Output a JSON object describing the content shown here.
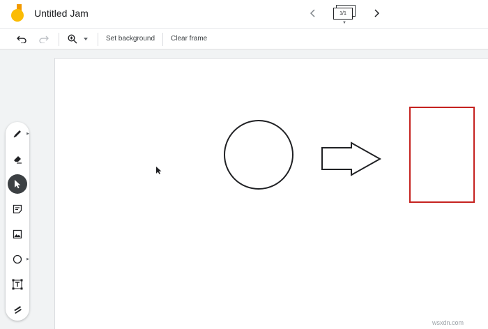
{
  "header": {
    "title": "Untitled Jam",
    "frame_indicator": "1/1",
    "logo_icon": "jamboard-logo"
  },
  "toolbar": {
    "set_background_label": "Set background",
    "clear_frame_label": "Clear frame"
  },
  "tools": [
    {
      "name": "pen",
      "icon": "pen-icon",
      "active": false
    },
    {
      "name": "eraser",
      "icon": "eraser-icon",
      "active": false
    },
    {
      "name": "select",
      "icon": "cursor-icon",
      "active": true
    },
    {
      "name": "sticky-note",
      "icon": "sticky-note-icon",
      "active": false
    },
    {
      "name": "image",
      "icon": "image-icon",
      "active": false
    },
    {
      "name": "shape",
      "icon": "circle-icon",
      "active": false
    },
    {
      "name": "text-box",
      "icon": "text-box-icon",
      "active": false
    },
    {
      "name": "laser",
      "icon": "laser-icon",
      "active": false
    }
  ],
  "canvas": {
    "shapes": [
      "circle",
      "arrow",
      "rectangle"
    ],
    "colors": {
      "stroke": "#202124",
      "rectangle": "#c5221f"
    }
  },
  "watermark": "wsxdn.com",
  "colors": {
    "background": "#f1f3f4",
    "active_tool": "#3c4043",
    "logo_yellow": "#fbbc04",
    "logo_orange": "#f29900"
  }
}
